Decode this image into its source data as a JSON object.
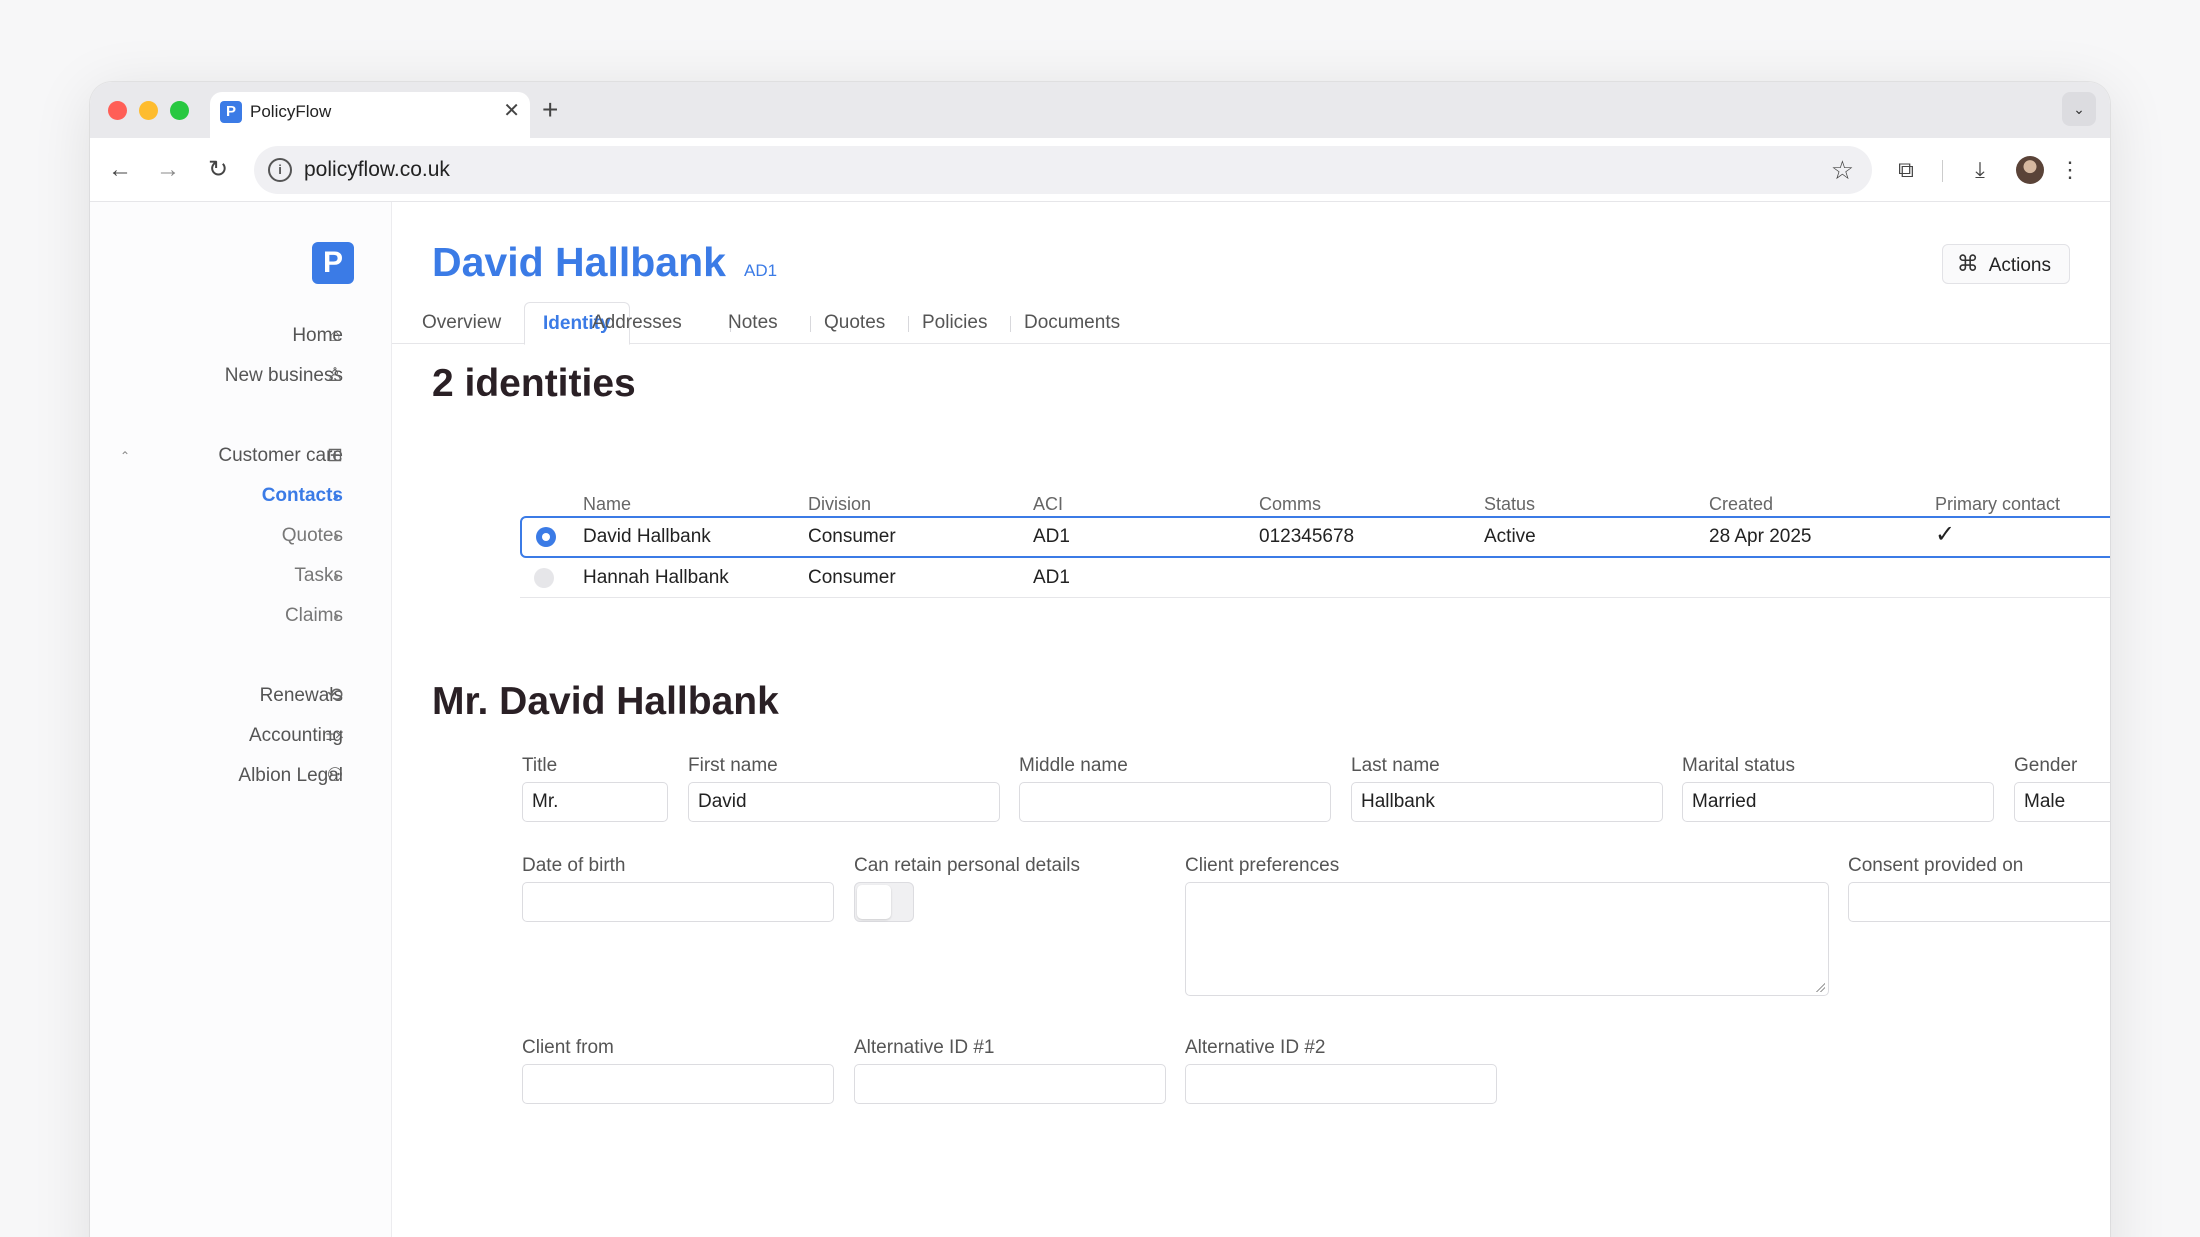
{
  "browser": {
    "tab_title": "PolicyFlow",
    "tab_favicon": "P",
    "url": "policyflow.co.uk"
  },
  "app": {
    "logo_letter": "P",
    "brand_color": "#3b7be6"
  },
  "sidebar": {
    "items": [
      {
        "label": "Home",
        "icon": "home-icon"
      },
      {
        "label": "New business",
        "icon": "new-business-icon"
      },
      {
        "label": "Customer care",
        "icon": "grid-icon"
      },
      {
        "label": "Contacts",
        "active": true
      },
      {
        "label": "Quotes"
      },
      {
        "label": "Tasks"
      },
      {
        "label": "Claims"
      },
      {
        "label": "Renewals",
        "icon": "refresh-icon"
      },
      {
        "label": "Accounting",
        "icon": "calculator-icon"
      },
      {
        "label": "Albion Legal",
        "icon": "user-icon"
      }
    ]
  },
  "header": {
    "title": "David Hallbank",
    "code": "AD1",
    "actions_label": "Actions"
  },
  "tabs": [
    "Overview",
    "Identity",
    "Addresses",
    "Notes",
    "Quotes",
    "Policies",
    "Documents"
  ],
  "identities": {
    "heading": "2 identities",
    "columns": [
      "Name",
      "Division",
      "ACI",
      "Comms",
      "Status",
      "Created",
      "Primary contact"
    ],
    "rows": [
      {
        "selected": true,
        "name": "David Hallbank",
        "division": "Consumer",
        "aci": "AD1",
        "comms": "012345678",
        "status": "Active",
        "created": "28 Apr 2025",
        "primary": "✓"
      },
      {
        "selected": false,
        "name": "Hannah Hallbank",
        "division": "Consumer",
        "aci": "AD1",
        "comms": "",
        "status": "",
        "created": "",
        "primary": ""
      }
    ]
  },
  "form": {
    "heading": "Mr. David Hallbank",
    "title_label": "Title",
    "title_value": "Mr.",
    "first_name_label": "First name",
    "first_name_value": "David",
    "middle_name_label": "Middle name",
    "middle_name_value": "",
    "last_name_label": "Last name",
    "last_name_value": "Hallbank",
    "marital_status_label": "Marital status",
    "marital_status_value": "Married",
    "gender_label": "Gender",
    "gender_value": "Male",
    "dob_label": "Date of birth",
    "retain_label": "Can retain personal details",
    "retain_value": false,
    "preferences_label": "Client preferences",
    "consent_label": "Consent provided on",
    "client_from_label": "Client from",
    "alt_id1_label": "Alternative ID #1",
    "alt_id2_label": "Alternative ID #2"
  }
}
